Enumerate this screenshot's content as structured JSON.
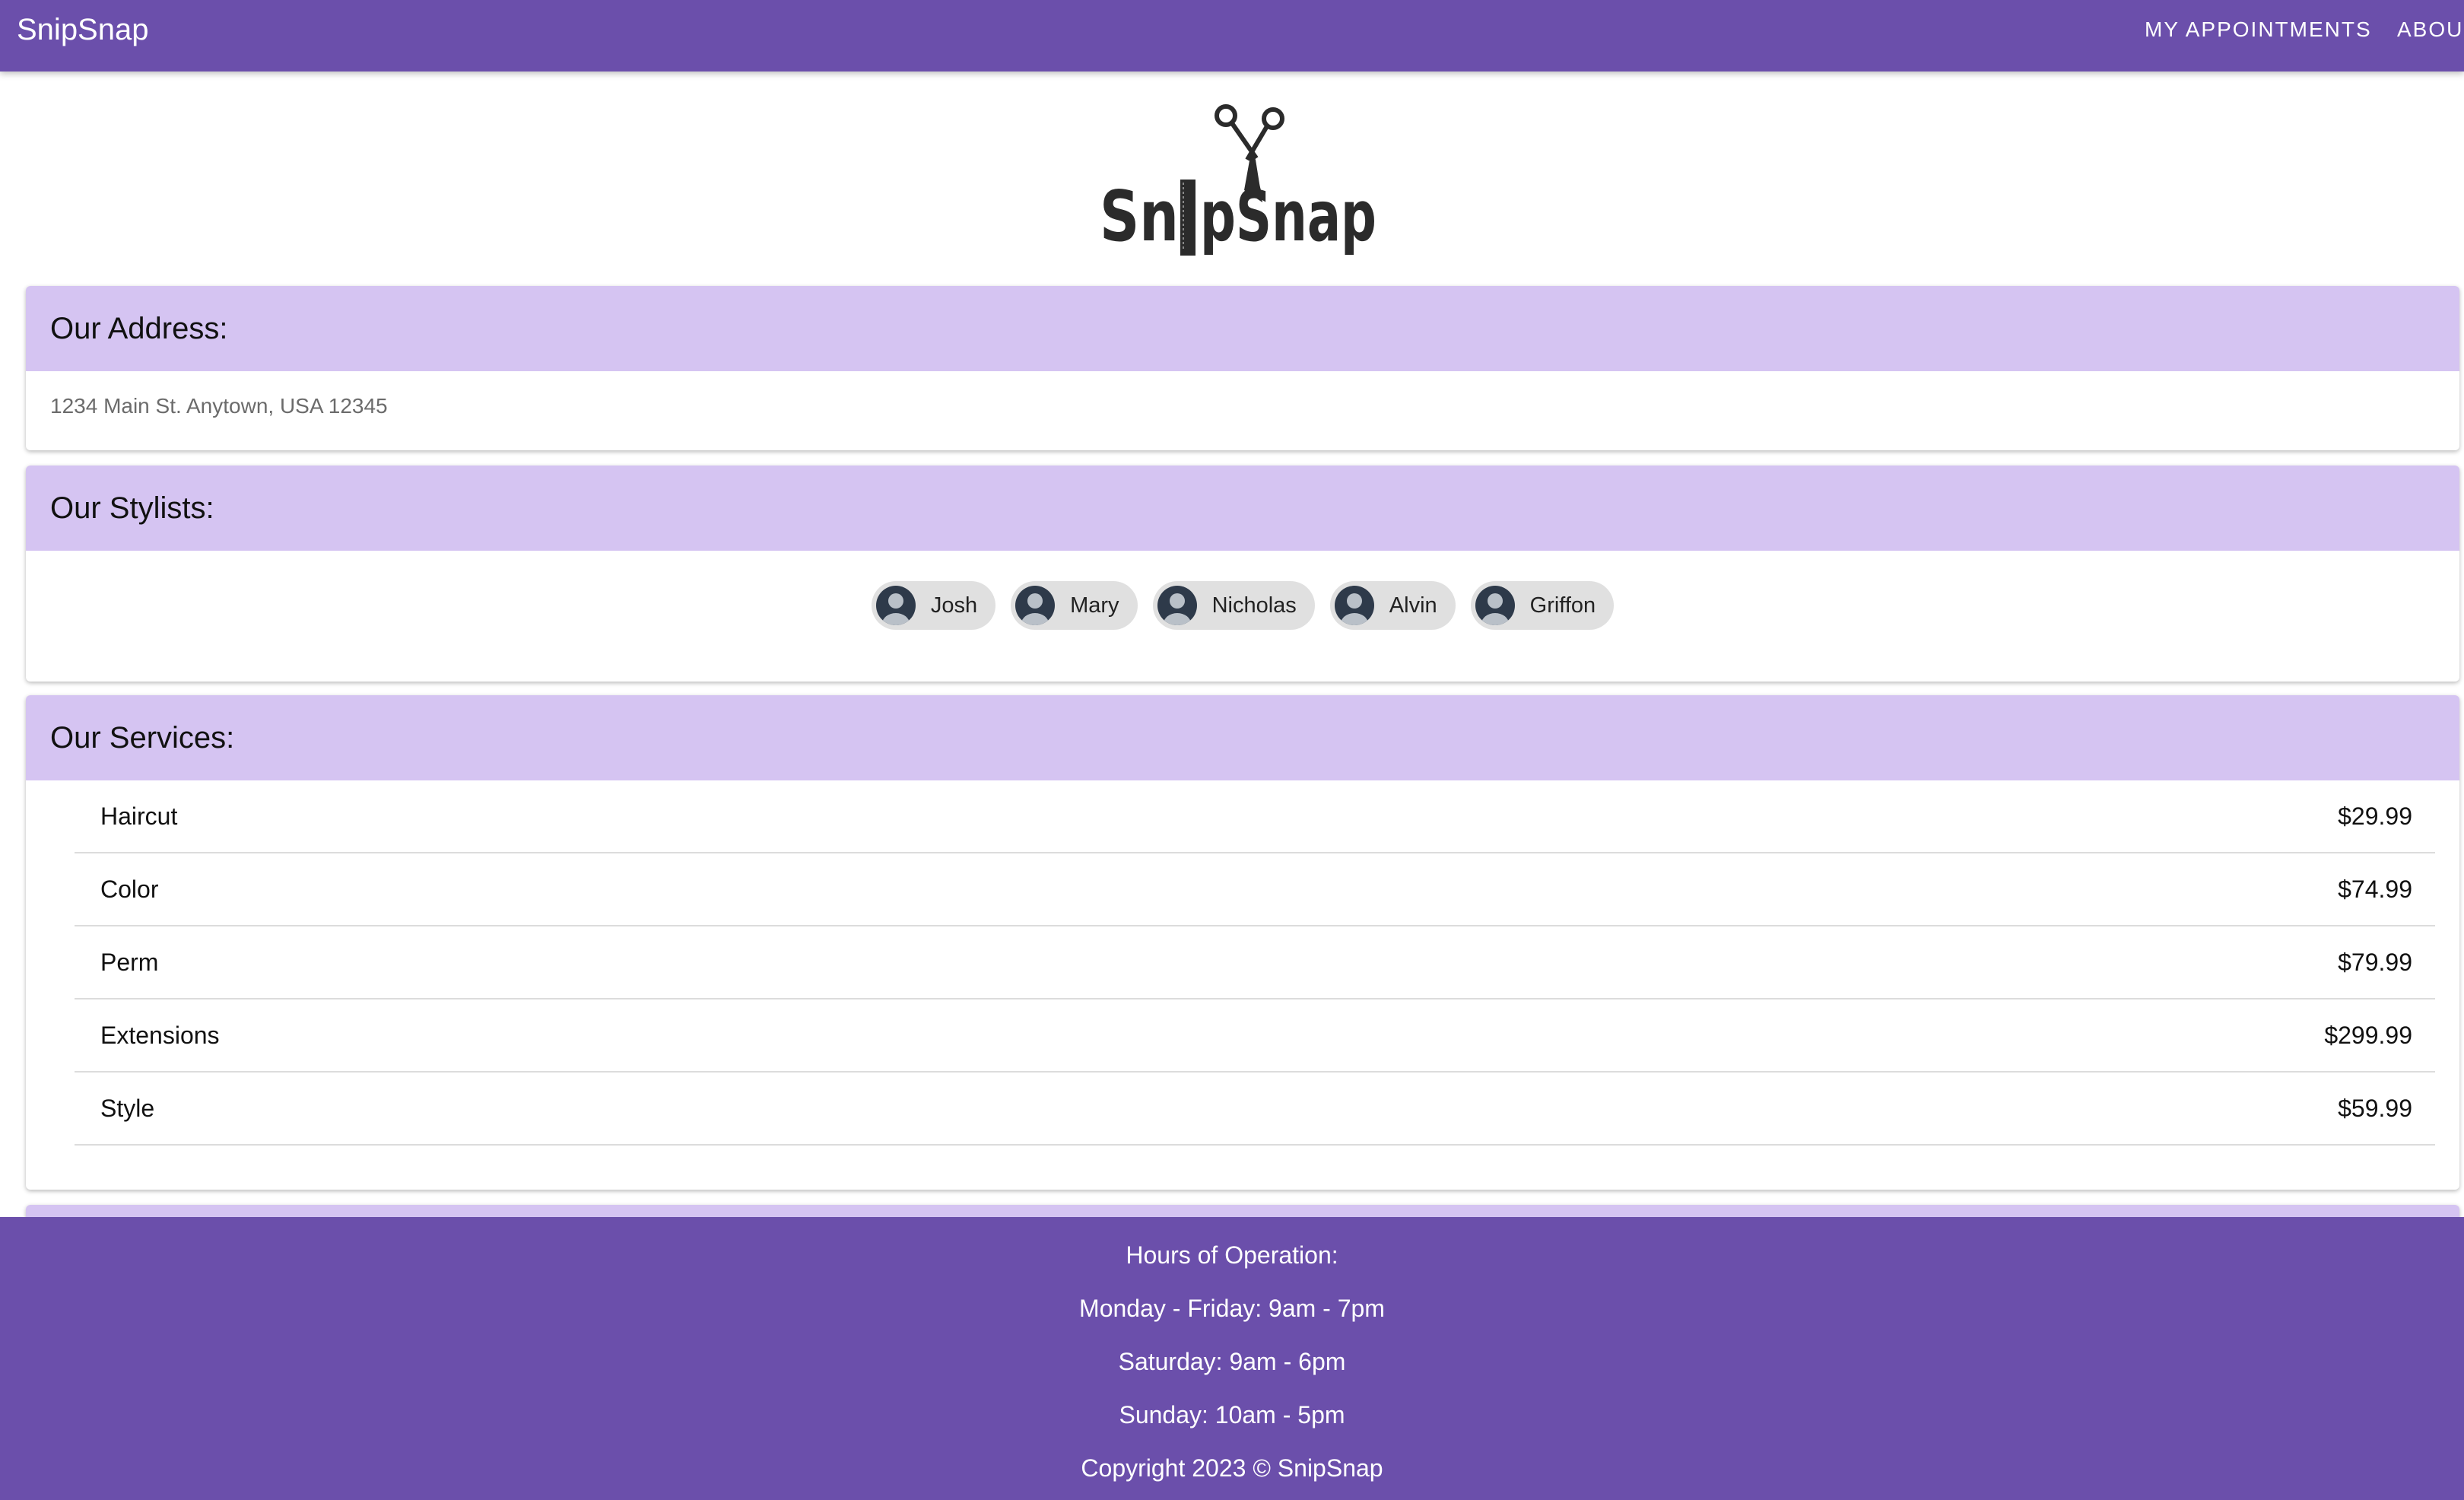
{
  "header": {
    "brand": "SnipSnap",
    "nav": [
      "MY APPOINTMENTS",
      "ABOU"
    ]
  },
  "logo": {
    "text": "SnipSnap"
  },
  "address": {
    "title": "Our Address:",
    "text": "1234 Main St. Anytown, USA 12345"
  },
  "stylists": {
    "title": "Our Stylists:",
    "items": [
      "Josh",
      "Mary",
      "Nicholas",
      "Alvin",
      "Griffon"
    ]
  },
  "services": {
    "title": "Our Services:",
    "items": [
      {
        "name": "Haircut",
        "price": "$29.99"
      },
      {
        "name": "Color",
        "price": "$74.99"
      },
      {
        "name": "Perm",
        "price": "$79.99"
      },
      {
        "name": "Extensions",
        "price": "$299.99"
      },
      {
        "name": "Style",
        "price": "$59.99"
      }
    ]
  },
  "footer": {
    "hours_title": "Hours of Operation:",
    "lines": [
      "Monday - Friday: 9am - 7pm",
      "Saturday: 9am - 6pm",
      "Sunday: 10am - 5pm"
    ],
    "copyright": "Copyright 2023 © SnipSnap"
  },
  "colors": {
    "primary": "#6b4fab",
    "card_header": "#d5c4f2",
    "chip": "#e0e0e0"
  },
  "icons": [
    "scissors-icon",
    "comb-icon",
    "person-icon"
  ]
}
